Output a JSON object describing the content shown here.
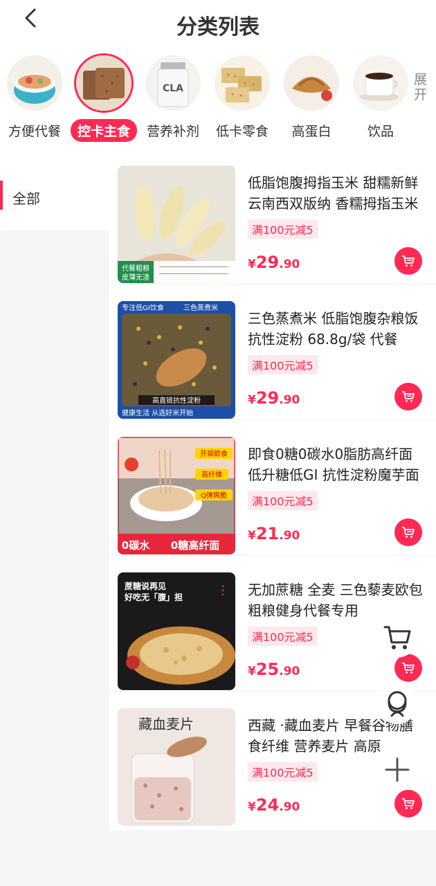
{
  "header": {
    "title": "分类列表"
  },
  "icons": {
    "back": "chevron-left-icon",
    "cart": "cart-icon",
    "service": "headset-icon",
    "plus": "plus-icon"
  },
  "colors": {
    "accent": "#ff2a54",
    "promo_bg": "#fde9ec",
    "sidebar_bg": "#f6f6f8"
  },
  "categories": [
    {
      "label": "方便代餐",
      "active": false,
      "image": "bowl"
    },
    {
      "label": "控卡主食",
      "active": true,
      "image": "bread"
    },
    {
      "label": "营养补剂",
      "active": false,
      "image": "cla-bottle"
    },
    {
      "label": "低卡零食",
      "active": false,
      "image": "crackers"
    },
    {
      "label": "高蛋白",
      "active": false,
      "image": "croissant"
    },
    {
      "label": "饮品",
      "active": false,
      "image": "coffee"
    }
  ],
  "expand_label": "展开",
  "sidebar": {
    "items": [
      {
        "label": "全部",
        "active": true
      }
    ]
  },
  "products": [
    {
      "name": "低脂饱腹拇指玉米 甜糯新鲜 云南西双版纳 香糯拇指玉米",
      "promo": "满100元减5",
      "price_symbol": "¥",
      "price_int": "29",
      "price_dec": ".90",
      "image_text": [
        "代餐粗粮",
        "皮薄无渣"
      ]
    },
    {
      "name": "三色蒸煮米 低脂饱腹杂粮饭 抗性淀粉 68.8g/袋 代餐",
      "promo": "满100元减5",
      "price_symbol": "¥",
      "price_int": "29",
      "price_dec": ".90",
      "image_text": [
        "专注低GI饮食",
        "三色蒸煮米",
        "高直链抗性淀粉",
        "健康生活 从选好米开始"
      ]
    },
    {
      "name": "即食0糖0碳水0脂肪高纤面 低升糖低GI 抗性淀粉魔芋面",
      "promo": "满100元减5",
      "price_symbol": "¥",
      "price_int": "21",
      "price_dec": ".90",
      "image_text": [
        "开袋即食",
        "高纤维",
        "Q弹爽脆",
        "0碳水",
        "0糖高纤面"
      ]
    },
    {
      "name": "无加蔗糖 全麦 三色藜麦欧包粗粮健身代餐专用",
      "promo": "满100元减5",
      "price_symbol": "¥",
      "price_int": "25",
      "price_dec": ".90",
      "image_text": [
        "蔗糖说再见",
        "好吃无「腹」担"
      ]
    },
    {
      "name": "西藏 ·藏血麦片 早餐谷物膳食纤维 营养麦片 高原",
      "promo": "满100元减5",
      "price_symbol": "¥",
      "price_int": "24",
      "price_dec": ".90",
      "image_text": [
        "藏血麦片"
      ]
    }
  ]
}
